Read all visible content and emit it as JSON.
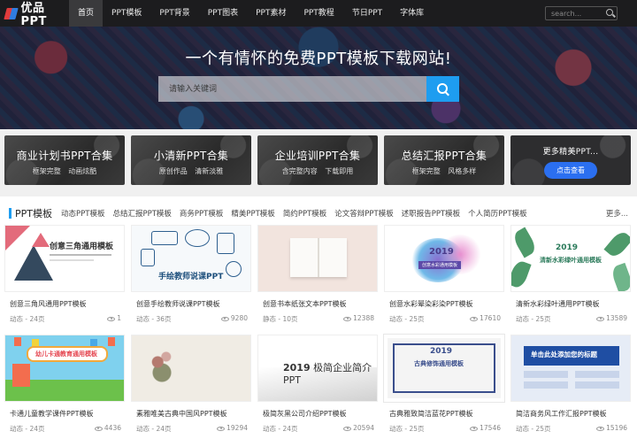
{
  "nav": {
    "logo": "优品PPT",
    "items": [
      "首页",
      "PPT模板",
      "PPT背景",
      "PPT图表",
      "PPT素材",
      "PPT教程",
      "节日PPT",
      "字体库"
    ],
    "search_placeholder": "search..."
  },
  "hero": {
    "title": "一个有情怀的免费PPT模板下载网站!",
    "search_placeholder": "请输入关键词"
  },
  "categories": [
    {
      "title": "商业计划书PPT合集",
      "sub": "框架完整 动画炫酷"
    },
    {
      "title": "小清新PPT合集",
      "sub": "原创作品 清新淡雅"
    },
    {
      "title": "企业培训PPT合集",
      "sub": "含完整内容 下载即用"
    },
    {
      "title": "总结汇报PPT合集",
      "sub": "框架完整 风格多样"
    }
  ],
  "more_card": {
    "title": "更多精美PPT...",
    "button": "点击查看"
  },
  "section": {
    "title": "PPT模板",
    "tabs": [
      "动态PPT模板",
      "总结汇报PPT模板",
      "商务PPT模板",
      "精美PPT模板",
      "简约PPT模板",
      "论文答辩PPT模板",
      "述职报告PPT模板",
      "个人简历PPT模板"
    ],
    "more": "更多..."
  },
  "thumb_text": {
    "t1": "创意三角通用模板",
    "t2": "手绘教师说课PPT",
    "t3": "",
    "t4": "2019",
    "t4_sub": "创意水彩通用模板",
    "t5": "2019",
    "t5_sub": "清新水彩绿叶通用模板",
    "t6": "幼儿卡通教育通用模板",
    "t7": "",
    "t8_year": "2019",
    "t8_text": "极简企业简介PPT",
    "t9": "2019",
    "t9_sub": "古典修饰通用模板",
    "t10": "单击此处添加您的标题"
  },
  "cards": [
    {
      "title": "创意三角风通用PPT模板",
      "meta": "动态 - 24页",
      "views": "1"
    },
    {
      "title": "创意手绘教师说课PPT模板",
      "meta": "动态 - 36页",
      "views": "9280"
    },
    {
      "title": "创意书本纸张文本PPT模板",
      "meta": "静态 - 10页",
      "views": "12388"
    },
    {
      "title": "创意水彩晕染彩染PPT模板",
      "meta": "动态 - 25页",
      "views": "17610"
    },
    {
      "title": "清新水彩绿叶通用PPT模板",
      "meta": "动态 - 25页",
      "views": "13589"
    },
    {
      "title": "卡通儿童教学课件PPT模板",
      "meta": "动态 - 24页",
      "views": "4436"
    },
    {
      "title": "素雅唯美古典中国风PPT模板",
      "meta": "动态 - 24页",
      "views": "19294"
    },
    {
      "title": "极简灰黑公司介绍PPT模板",
      "meta": "动态 - 24页",
      "views": "20594"
    },
    {
      "title": "古典雅致简洁蓝花PPT模板",
      "meta": "动态 - 25页",
      "views": "17546"
    },
    {
      "title": "简洁商务风工作汇报PPT模板",
      "meta": "动态 - 25页",
      "views": "15196"
    }
  ]
}
